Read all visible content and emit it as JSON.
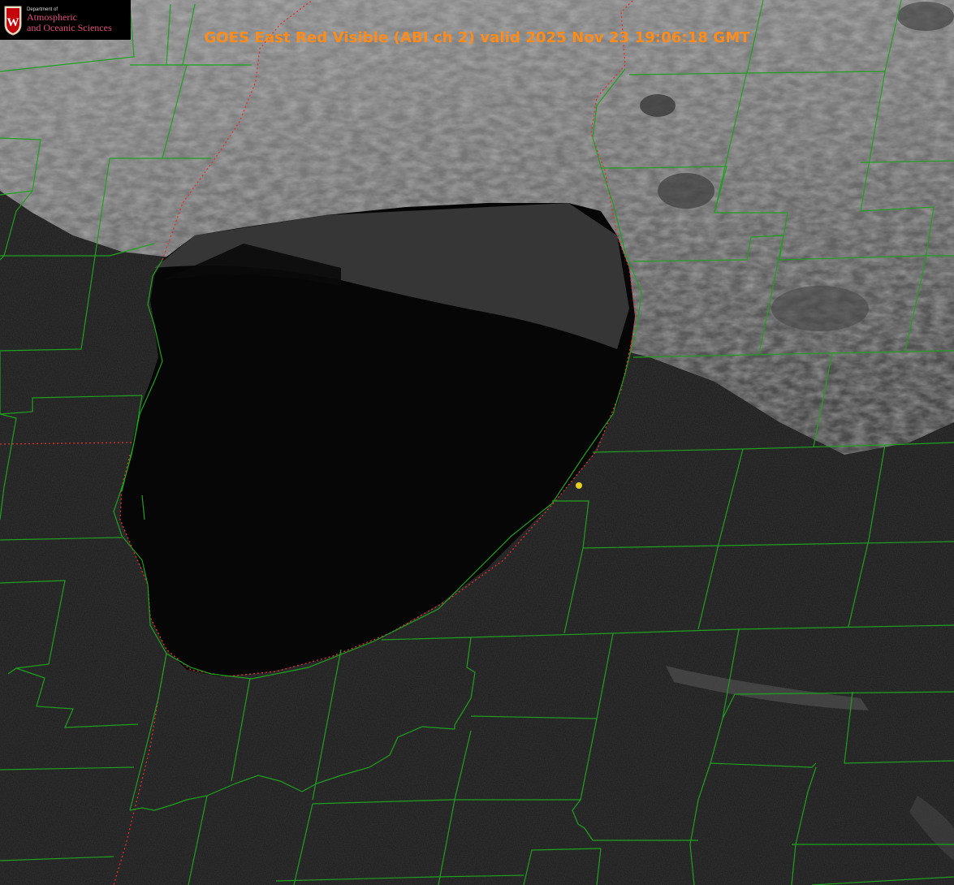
{
  "logo": {
    "department": "Department of",
    "line1": "Atmospheric",
    "line2": "and Oceanic Sciences",
    "icon": "uw-crest-icon"
  },
  "title": "GOES East Red Visible (ABI ch 2) valid 2025 Nov 23 19:06:18 GMT",
  "colors": {
    "title": "#ff8c1a",
    "county_lines": "#1fa01f",
    "state_lines": "#e03030",
    "marker": "#e6d21e",
    "lake": "#050505",
    "land": "#1c1c1c",
    "cloud": "#9a9a9a"
  },
  "layers": [
    "satellite-visible-imagery",
    "county-boundaries",
    "state-boundaries",
    "location-marker"
  ]
}
